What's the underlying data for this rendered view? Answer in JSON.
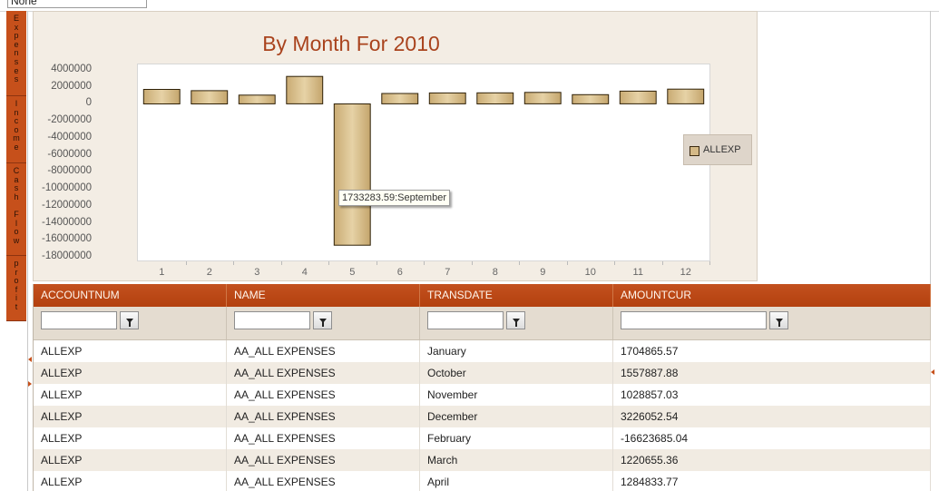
{
  "top_combo": {
    "value": "None"
  },
  "left_tabs": [
    {
      "label": "Expenses"
    },
    {
      "label": "Income"
    },
    {
      "label": "Cash Flow"
    },
    {
      "label": "profit"
    }
  ],
  "colors": {
    "accent": "#c6501b",
    "header": "#b9461a",
    "bar_fill": "#d4b987",
    "panel_bg": "#f3ede4",
    "alt_row": "#f1ebe2"
  },
  "chart_data": {
    "type": "bar",
    "title": "By Month For 2010",
    "categories": [
      "1",
      "2",
      "3",
      "4",
      "5",
      "6",
      "7",
      "8",
      "9",
      "10",
      "11",
      "12"
    ],
    "series": [
      {
        "name": "ALLEXP",
        "values": [
          1704865.57,
          1557887.88,
          1028857.03,
          3226052.54,
          -16623685.04,
          1220655.36,
          1284833.77,
          1300000,
          1350000,
          1080000,
          1500000,
          1733283.59
        ]
      }
    ],
    "yticks": [
      "4000000",
      "2000000",
      "0",
      "-2000000",
      "-4000000",
      "-6000000",
      "-8000000",
      "-10000000",
      "-12000000",
      "-14000000",
      "-16000000",
      "-18000000"
    ],
    "ylim": [
      -18000000,
      4000000
    ],
    "legend": {
      "label": "ALLEXP",
      "position": "right"
    },
    "tooltip": "1733283.59:September",
    "grid": false
  },
  "grid": {
    "columns": [
      "ACCOUNTNUM",
      "NAME",
      "TRANSDATE",
      "AMOUNTCUR"
    ],
    "rows": [
      [
        "ALLEXP",
        "AA_ALL EXPENSES",
        "January",
        "1704865.57"
      ],
      [
        "ALLEXP",
        "AA_ALL EXPENSES",
        "October",
        "1557887.88"
      ],
      [
        "ALLEXP",
        "AA_ALL EXPENSES",
        "November",
        "1028857.03"
      ],
      [
        "ALLEXP",
        "AA_ALL EXPENSES",
        "December",
        "3226052.54"
      ],
      [
        "ALLEXP",
        "AA_ALL EXPENSES",
        "February",
        "-16623685.04"
      ],
      [
        "ALLEXP",
        "AA_ALL EXPENSES",
        "March",
        "1220655.36"
      ],
      [
        "ALLEXP",
        "AA_ALL EXPENSES",
        "April",
        "1284833.77"
      ]
    ]
  }
}
